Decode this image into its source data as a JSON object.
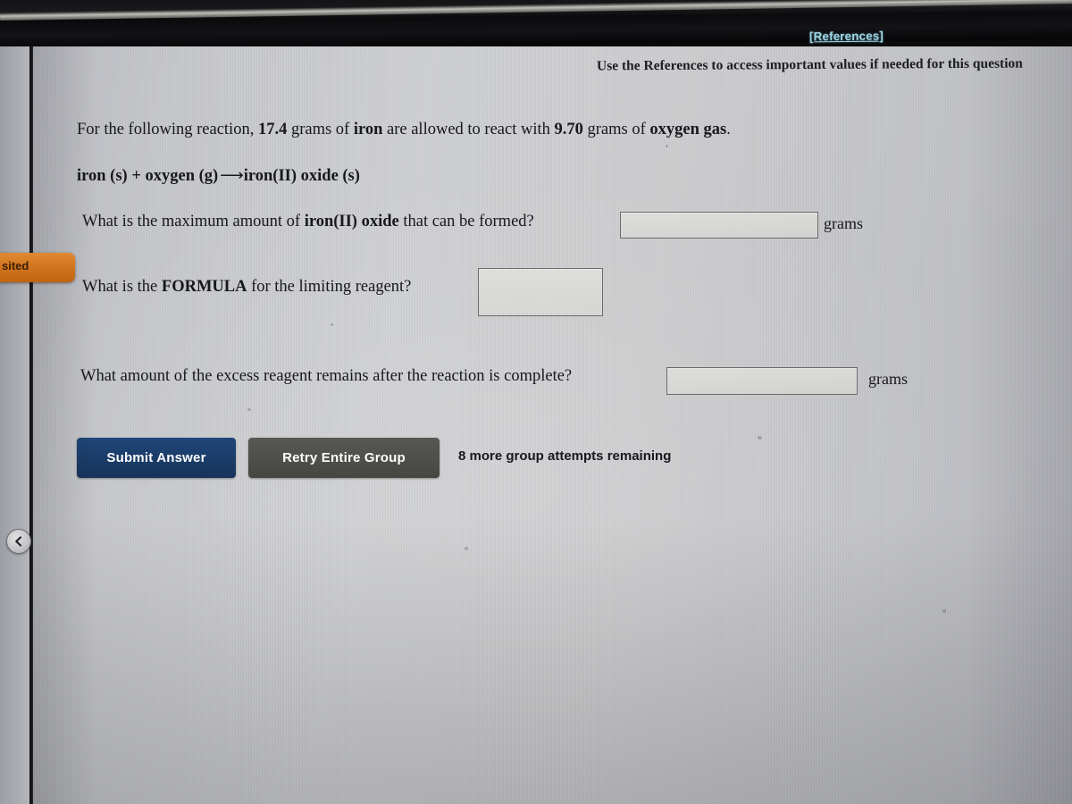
{
  "bezel": {
    "references_label": "[References]"
  },
  "header": {
    "instruction": "Use the References to access important values if needed for this question"
  },
  "sidebar": {
    "visited_tab_label": "sited",
    "back_handle_icon": "chevron-left-icon"
  },
  "question": {
    "prompt_prefix": "For the following reaction, ",
    "mass_iron": "17.4",
    "prompt_mid1": " grams of ",
    "reactant1": "iron",
    "prompt_mid2": " are allowed to react with ",
    "mass_oxygen": "9.70",
    "prompt_mid3": " grams of ",
    "reactant2": "oxygen gas",
    "prompt_end": ".",
    "equation_left": "iron (s) + oxygen (g)",
    "equation_arrow": "⟶",
    "equation_right": "iron(II) oxide (s)",
    "q1_prefix": "What is the maximum amount of ",
    "q1_bold": "iron(II) oxide",
    "q1_suffix": " that can be formed?",
    "q1_unit": "grams",
    "q1_value": "",
    "q1_placeholder": "",
    "q2_prefix": "What is the ",
    "q2_bold": "FORMULA",
    "q2_suffix": " for the limiting reagent?",
    "q2_value": "",
    "q2_placeholder": "",
    "q3_text": "What amount of the excess reagent remains after the reaction is complete?",
    "q3_unit": "grams",
    "q3_value": "",
    "q3_placeholder": ""
  },
  "actions": {
    "submit_label": "Submit Answer",
    "retry_label": "Retry Entire Group",
    "attempts_text": "8 more group attempts remaining"
  },
  "colors": {
    "submit_button": "#1b3c68",
    "retry_button": "#4e4f4b",
    "references_link": "#9fd3e2",
    "visited_tab": "#d2761f"
  }
}
